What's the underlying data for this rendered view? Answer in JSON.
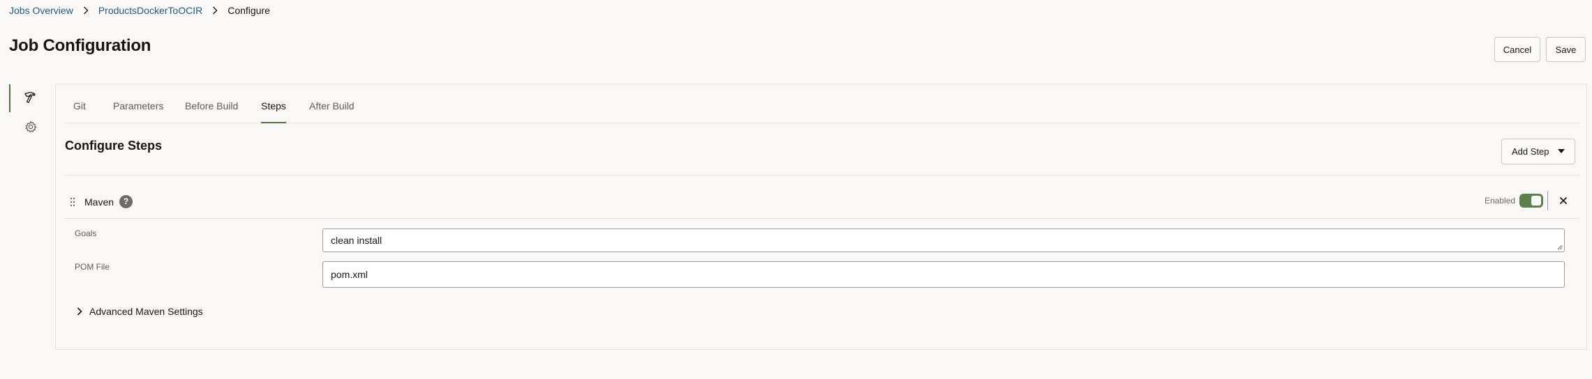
{
  "breadcrumb": {
    "items": [
      "Jobs Overview",
      "ProductsDockerToOCIR"
    ],
    "current": "Configure"
  },
  "page": {
    "title": "Job Configuration"
  },
  "header_actions": {
    "cancel_label": "Cancel",
    "save_label": "Save"
  },
  "side_rail": {
    "items": [
      {
        "icon": "hammer-icon",
        "active": true
      },
      {
        "icon": "gear-icon",
        "active": false
      }
    ]
  },
  "tabs": [
    {
      "label": "Git"
    },
    {
      "label": "Parameters"
    },
    {
      "label": "Before Build"
    },
    {
      "label": "Steps",
      "active": true
    },
    {
      "label": "After Build"
    }
  ],
  "section": {
    "title": "Configure Steps",
    "add_step_label": "Add Step"
  },
  "step": {
    "name": "Maven",
    "help_glyph": "?",
    "enabled_label": "Enabled",
    "enabled": true,
    "goals_label": "Goals",
    "goals_value": "clean install",
    "pom_label": "POM File",
    "pom_value": "pom.xml",
    "advanced_label": "Advanced Maven Settings"
  },
  "colors": {
    "accent": "#4f7342",
    "link": "#1b5a86",
    "toggle_on": "#5c7f4d",
    "background": "#f9f8f6"
  }
}
